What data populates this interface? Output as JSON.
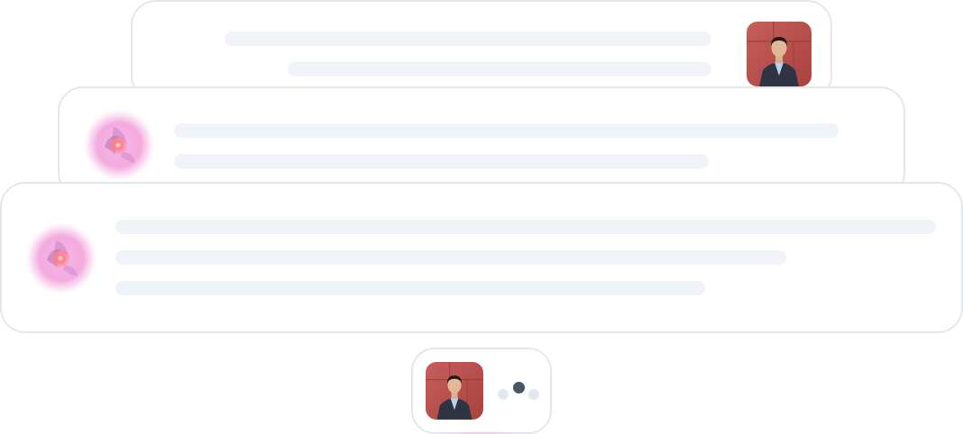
{
  "colors": {
    "card_border": "#e3e8ef",
    "placeholder_line": "#f0f4f8",
    "orb_glow": "#f3a6dd",
    "orb_core": "#ff6f7a",
    "typing_dot_active": "#4a5563",
    "typing_dot_idle": "#e3e8ef"
  },
  "icons": {
    "user_avatar": "user-avatar-photo",
    "assistant_avatar": "assistant-orb-icon",
    "typing_indicator": "typing-dots-icon"
  },
  "messages": [
    {
      "role": "user",
      "text_lines": 2
    },
    {
      "role": "assistant",
      "text_lines": 2
    },
    {
      "role": "assistant",
      "text_lines": 3
    }
  ],
  "typing": {
    "role": "user",
    "active_dot": 2,
    "dot_count": 3
  }
}
